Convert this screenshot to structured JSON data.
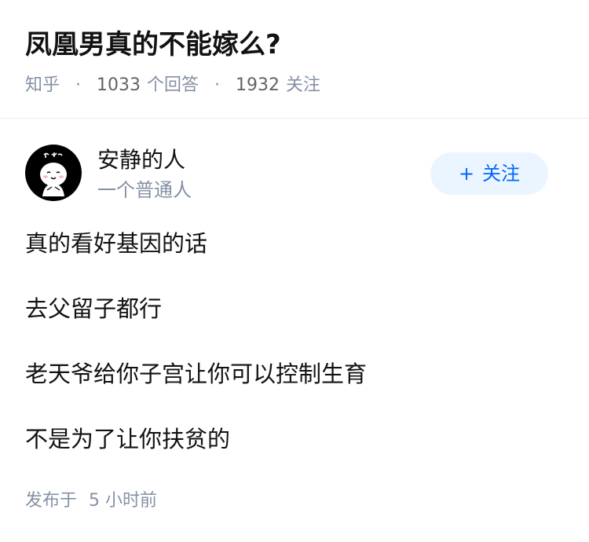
{
  "question": {
    "title": "凤凰男真的不能嫁么?",
    "source": "知乎",
    "separator": "·",
    "answer_count": "1033",
    "answer_label": "个回答",
    "follower_count": "1932",
    "follower_label": "关注"
  },
  "author": {
    "name": "安静的人",
    "bio": "一个普通人",
    "avatar_icon": "cartoon-face-icon",
    "follow_plus": "+",
    "follow_label": "关注"
  },
  "answer": {
    "paragraphs": [
      "真的看好基因的话",
      "去父留子都行",
      "老天爷给你子宫让你可以控制生育",
      "不是为了让你扶贫的"
    ],
    "publish_label": "发布于",
    "publish_time": "5 小时前"
  },
  "colors": {
    "meta_gray": "#8590a6",
    "accent_blue": "#0066ff",
    "follow_bg": "#ebf5ff"
  }
}
